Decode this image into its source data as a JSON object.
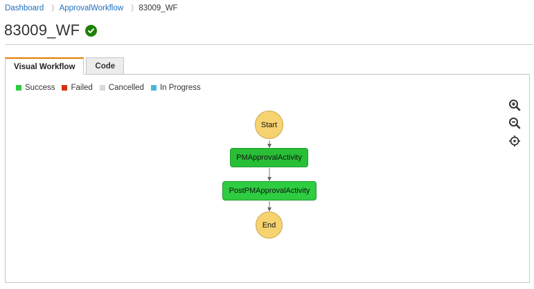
{
  "breadcrumb": {
    "items": [
      "Dashboard",
      "ApprovalWorkflow"
    ],
    "current": "83009_WF",
    "separator": "⟩"
  },
  "header": {
    "title": "83009_WF",
    "status": "Success"
  },
  "tabs": [
    {
      "label": "Visual Workflow",
      "active": true
    },
    {
      "label": "Code",
      "active": false
    }
  ],
  "legend": [
    {
      "label": "Success",
      "color": "#2ecc40"
    },
    {
      "label": "Failed",
      "color": "#d13212"
    },
    {
      "label": "Cancelled",
      "color": "#d5dbdb"
    },
    {
      "label": "In Progress",
      "color": "#44b9d6"
    }
  ],
  "zoom": {
    "icons": [
      "zoom-in-icon",
      "zoom-out-icon",
      "center-icon"
    ]
  },
  "workflow": {
    "nodes": [
      {
        "id": "start",
        "label": "Start",
        "kind": "state"
      },
      {
        "id": "pm-approval",
        "label": "PMApprovalActivity",
        "kind": "task",
        "status": "Success"
      },
      {
        "id": "post-pm-approval",
        "label": "PostPMApprovalActivity",
        "kind": "task",
        "status": "Success"
      },
      {
        "id": "end",
        "label": "End",
        "kind": "state"
      }
    ]
  }
}
